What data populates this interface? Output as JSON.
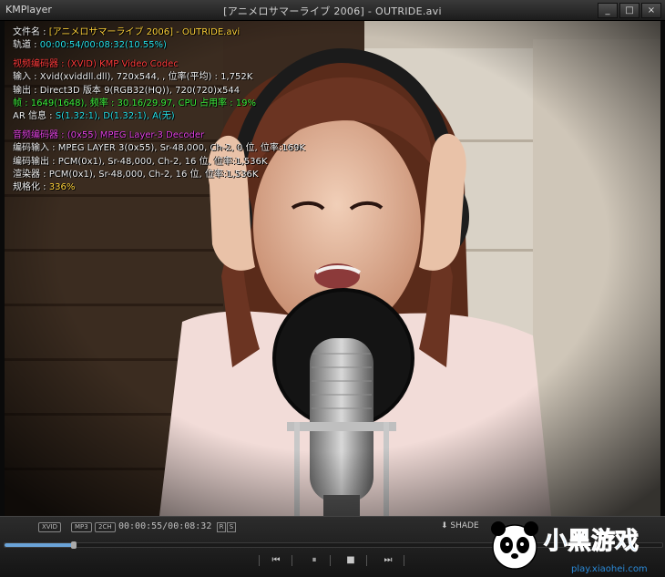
{
  "window": {
    "app_name": "KMPlayer",
    "file_title": "[アニメロサマーライブ 2006] - OUTRIDE.avi",
    "minimize": "_",
    "maximize": "□",
    "close": "×"
  },
  "osd": {
    "line1_label": "文件名 : ",
    "line1_value": "[アニメロサマーライブ 2006] - OUTRIDE.avi",
    "line2_label": "轨道 : ",
    "line2_value": "00:00:54/00:08:32(10.55%)",
    "line3": "视频编码器 : (XVID) KMP Video Codec",
    "line4": "输入 : Xvid(xviddll.dll), 720x544, , 位率(平均) : 1,752K",
    "line5": "输出 : Direct3D 版本 9(RGB32(HQ)), 720(720)x544",
    "line6": "帧 : 1649(1648), 频率 : 30.16/29.97, CPU 占用率 : 19%",
    "line7_label": "AR 信息 : ",
    "line7_value": "S(1.32:1), D(1.32:1), A(无)",
    "line8": "音频编码器 : (0x55) MPEG Layer-3 Decoder",
    "line9": "编码输入 : MPEG LAYER 3(0x55), Sr-48,000, Ch-2, 0 位, 位率:169K",
    "line10": "编码输出 : PCM(0x1), Sr-48,000, Ch-2, 16 位, 位率:1,536K",
    "line11": "渲染器 : PCM(0x1), Sr-48,000, Ch-2, 16 位, 位率:1,536K",
    "line12_label": "规格化 : ",
    "line12_value": "336%"
  },
  "controls": {
    "badge_video": "XVID",
    "badge_audio": "MP3",
    "badge_channels": "2CH",
    "time": "00:00:55/00:08:32",
    "r_badge": "R",
    "s_badge": "S",
    "shade_label": "SHADE",
    "seek_progress": 0.1055
  },
  "transport": {
    "prev": "⏮",
    "pause": "⏸",
    "stop": "■",
    "next": "⏭"
  },
  "watermark": {
    "brand_cn": "小黑游戏",
    "brand_url": "play.xiaohei.com"
  },
  "colors": {
    "osd_white": "#f0f0f0",
    "osd_cyan": "#26e0e8",
    "osd_red": "#ff3a3a",
    "osd_green": "#3cf03c",
    "osd_magenta": "#e040e0",
    "osd_yellow": "#ffd23a",
    "seek_fill": "#6aa3d8"
  }
}
